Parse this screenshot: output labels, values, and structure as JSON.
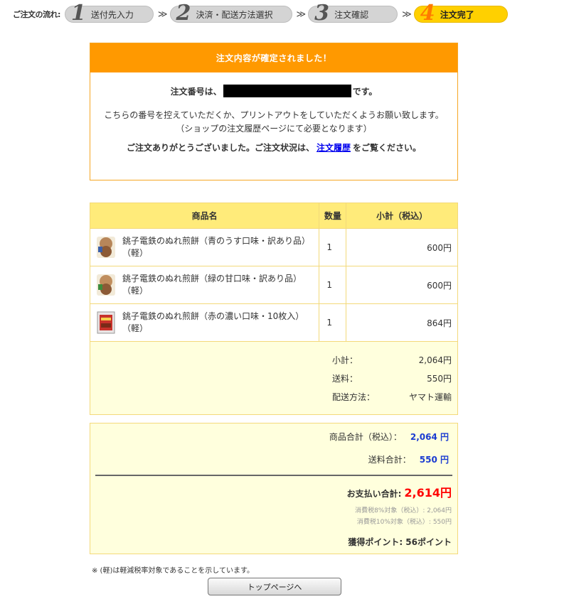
{
  "flow": {
    "label": "ご注文の流れ:",
    "steps": [
      {
        "num": "1",
        "label": "送付先入力"
      },
      {
        "num": "2",
        "label": "決済・配送方法選択"
      },
      {
        "num": "3",
        "label": "注文確認"
      },
      {
        "num": "4",
        "label": "注文完了"
      }
    ],
    "arrow": "≫"
  },
  "confirm": {
    "title": "注文内容が確定されました！",
    "order_prefix": "注文番号は、",
    "order_suffix": "です。",
    "note_line1": "こちらの番号を控えていただくか、プリントアウトをしていただくようお願い致します。",
    "note_line2": "（ショップの注文履歴ページにて必要となります）",
    "thanks_before": "ご注文ありがとうございました。ご注文状況は、",
    "history_link": "注文履歴",
    "thanks_after": "をご覧ください。"
  },
  "table": {
    "headers": {
      "name": "商品名",
      "qty": "数量",
      "subtotal": "小計（税込）"
    },
    "items": [
      {
        "name": "銚子電鉄のぬれ煎餅（青のうす口味・訳あり品）（軽）",
        "qty": "1",
        "subtotal": "600円",
        "thumb": "senbei-blue"
      },
      {
        "name": "銚子電鉄のぬれ煎餅（緑の甘口味・訳あり品）（軽）",
        "qty": "1",
        "subtotal": "600円",
        "thumb": "senbei-green"
      },
      {
        "name": "銚子電鉄のぬれ煎餅（赤の濃い口味・10枚入）（軽）",
        "qty": "1",
        "subtotal": "864円",
        "thumb": "senbei-red-pack"
      }
    ],
    "summary": {
      "subtotal_label": "小計：",
      "subtotal_value": "2,064円",
      "shipping_label": "送料：",
      "shipping_value": "550円",
      "method_label": "配送方法：",
      "method_value": "ヤマト運輸"
    }
  },
  "totals": {
    "goods_label": "商品合計（税込）：",
    "goods_value": "2,064 円",
    "shipping_label": "送料合計：",
    "shipping_value": "550 円",
    "grand_label": "お支払い合計:",
    "grand_value": "2,614円",
    "tax8": "消費税8%対象（税込）: 2,064円",
    "tax10": "消費税10%対象（税込）: 550円",
    "points": "獲得ポイント: 56ポイント"
  },
  "footnote": "※ (軽)は軽減税率対象であることを示しています。",
  "top_button": "トップページへ",
  "colors": {
    "accent_orange": "#ff9900",
    "step_active": "#ffd000",
    "table_header": "#ffeb7a",
    "total_red": "#ff0000",
    "total_blue": "#1a3bd1"
  }
}
